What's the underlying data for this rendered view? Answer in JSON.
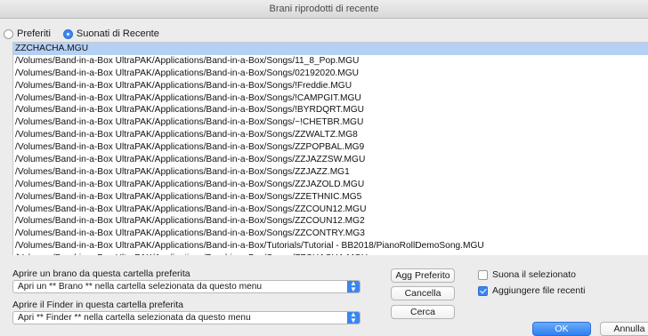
{
  "window": {
    "title": "Brani riprodotti di recente"
  },
  "view_mode": {
    "options": [
      {
        "label": "Preferiti",
        "selected": false
      },
      {
        "label": "Suonati di Recente",
        "selected": true
      }
    ]
  },
  "song_list": {
    "selected_index": 0,
    "items": [
      "ZZCHACHA.MGU",
      "/Volumes/Band-in-a-Box UltraPAK/Applications/Band-in-a-Box/Songs/11_8_Pop.MGU",
      "/Volumes/Band-in-a-Box UltraPAK/Applications/Band-in-a-Box/Songs/02192020.MGU",
      "/Volumes/Band-in-a-Box UltraPAK/Applications/Band-in-a-Box/Songs/!Freddie.MGU",
      "/Volumes/Band-in-a-Box UltraPAK/Applications/Band-in-a-Box/Songs/!CAMPGIT.MGU",
      "/Volumes/Band-in-a-Box UltraPAK/Applications/Band-in-a-Box/Songs/!BYRDQRT.MGU",
      "/Volumes/Band-in-a-Box UltraPAK/Applications/Band-in-a-Box/Songs/~!CHETBR.MGU",
      "/Volumes/Band-in-a-Box UltraPAK/Applications/Band-in-a-Box/Songs/ZZWALTZ.MG8",
      "/Volumes/Band-in-a-Box UltraPAK/Applications/Band-in-a-Box/Songs/ZZPOPBAL.MG9",
      "/Volumes/Band-in-a-Box UltraPAK/Applications/Band-in-a-Box/Songs/ZZJAZZSW.MGU",
      "/Volumes/Band-in-a-Box UltraPAK/Applications/Band-in-a-Box/Songs/ZZJAZZ.MG1",
      "/Volumes/Band-in-a-Box UltraPAK/Applications/Band-in-a-Box/Songs/ZZJAZOLD.MGU",
      "/Volumes/Band-in-a-Box UltraPAK/Applications/Band-in-a-Box/Songs/ZZETHNIC.MG5",
      "/Volumes/Band-in-a-Box UltraPAK/Applications/Band-in-a-Box/Songs/ZZCOUN12.MGU",
      "/Volumes/Band-in-a-Box UltraPAK/Applications/Band-in-a-Box/Songs/ZZCOUN12.MG2",
      "/Volumes/Band-in-a-Box UltraPAK/Applications/Band-in-a-Box/Songs/ZZCONTRY.MG3",
      "/Volumes/Band-in-a-Box UltraPAK/Applications/Band-in-a-Box/Tutorials/Tutorial - BB2018/PianoRollDemoSong.MGU",
      "/Volumes/Band-in-a-Box UltraPAK/Applications/Band-in-a-Box/Songs/ZZCHACHA.MGU"
    ]
  },
  "open_song": {
    "label": "Aprire un brano da questa cartella preferita",
    "select_value": "Apri un ** Brano ** nella cartella selezionata da questo menu"
  },
  "open_finder": {
    "label": "Aprire il Finder in questa cartella preferita",
    "select_value": "Apri ** Finder ** nella cartella selezionata da questo menu"
  },
  "buttons": {
    "add_favorite": "Agg Preferito",
    "delete": "Cancella",
    "search": "Cerca",
    "ok": "OK",
    "cancel": "Annulla"
  },
  "checkboxes": {
    "play_selected": {
      "label": "Suona il selezionato",
      "checked": false
    },
    "add_recent": {
      "label": "Aggiungere file recenti",
      "checked": true
    }
  },
  "icons": {
    "select_arrow": "updown-chevron-icon"
  },
  "colors": {
    "accent": "#3a86f0",
    "selection": "#b5d0f5"
  }
}
